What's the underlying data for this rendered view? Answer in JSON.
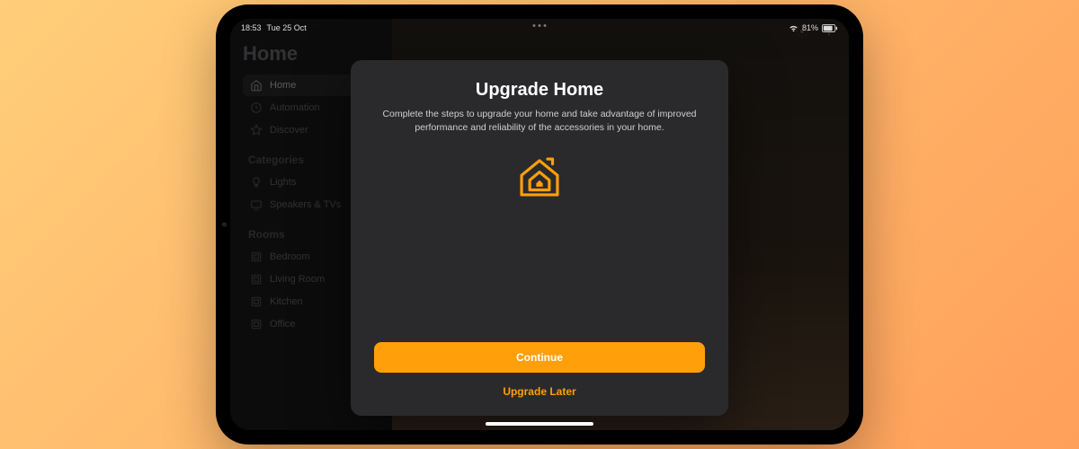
{
  "status": {
    "time": "18:53",
    "date": "Tue 25 Oct",
    "battery": "81%"
  },
  "sidebar": {
    "title": "Home",
    "nav": [
      {
        "label": "Home"
      },
      {
        "label": "Automation"
      },
      {
        "label": "Discover"
      }
    ],
    "categories": {
      "header": "Categories",
      "items": [
        {
          "label": "Lights"
        },
        {
          "label": "Speakers & TVs"
        }
      ]
    },
    "rooms": {
      "header": "Rooms",
      "items": [
        {
          "label": "Bedroom"
        },
        {
          "label": "Living Room"
        },
        {
          "label": "Kitchen"
        },
        {
          "label": "Office"
        }
      ]
    }
  },
  "modal": {
    "title": "Upgrade Home",
    "body": "Complete the steps to upgrade your home and take advantage of improved performance and reliability of the accessories in your home.",
    "primary": "Continue",
    "secondary": "Upgrade Later"
  },
  "colors": {
    "accent": "#ff9f0a"
  }
}
